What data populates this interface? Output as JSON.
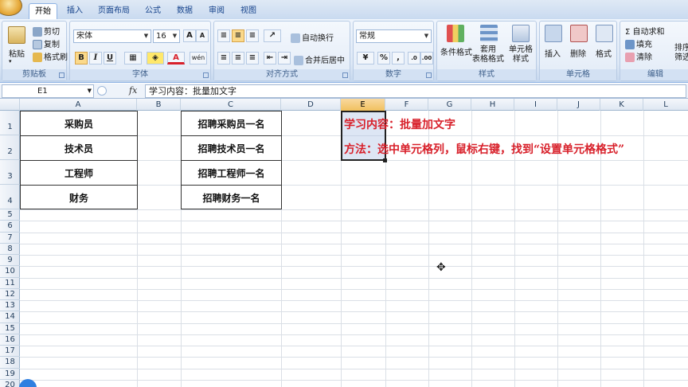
{
  "ribbon": {
    "tabs": [
      "开始",
      "插入",
      "页面布局",
      "公式",
      "数据",
      "审阅",
      "视图"
    ],
    "active_tab": "开始",
    "clipboard": {
      "paste": "粘贴",
      "cut": "剪切",
      "copy": "复制",
      "format_painter": "格式刷",
      "label": "剪贴板"
    },
    "font": {
      "name": "宋体",
      "size": "16",
      "label": "字体",
      "bold": "B",
      "italic": "I",
      "underline": "U",
      "grow": "A",
      "shrink": "A",
      "phonetic": "wén"
    },
    "alignment": {
      "wrap": "自动换行",
      "merge": "合并后居中",
      "label": "对齐方式"
    },
    "number": {
      "format": "常规",
      "percent": "%",
      "comma": ",",
      "label": "数字"
    },
    "styles": {
      "conditional": "条件格式",
      "table": "套用\n表格格式",
      "cell": "单元格\n样式",
      "label": "样式"
    },
    "cells": {
      "insert": "插入",
      "delete": "删除",
      "format": "格式",
      "label": "单元格"
    },
    "editing": {
      "autosum": "自动求和",
      "fill": "填充",
      "clear": "清除",
      "sort": "排序\n筛选",
      "label": "编辑"
    }
  },
  "formula_bar": {
    "name_box": "E1",
    "fx": "fx",
    "content": "学习内容：批量加文字"
  },
  "columns": [
    "A",
    "B",
    "C",
    "D",
    "E",
    "F",
    "G",
    "H",
    "I",
    "J",
    "K",
    "L"
  ],
  "rows": [
    "1",
    "2",
    "3",
    "4",
    "5",
    "6",
    "7",
    "8",
    "9",
    "10",
    "11",
    "12",
    "13",
    "14",
    "15",
    "16",
    "17",
    "18",
    "19",
    "20"
  ],
  "cells": {
    "A1": "采购员",
    "A2": "技术员",
    "A3": "工程师",
    "A4": "财务",
    "C1": "招聘采购员一名",
    "C2": "招聘技术员一名",
    "C3": "招聘工程师一名",
    "C4": "招聘财务一名",
    "E1": "学习内容：批量加文字",
    "E2": "方法：选中单元格列，鼠标右键，找到“设置单元格格式”"
  },
  "colors": {
    "accent_red": "#d8202a",
    "selection": "#f1c15f"
  }
}
